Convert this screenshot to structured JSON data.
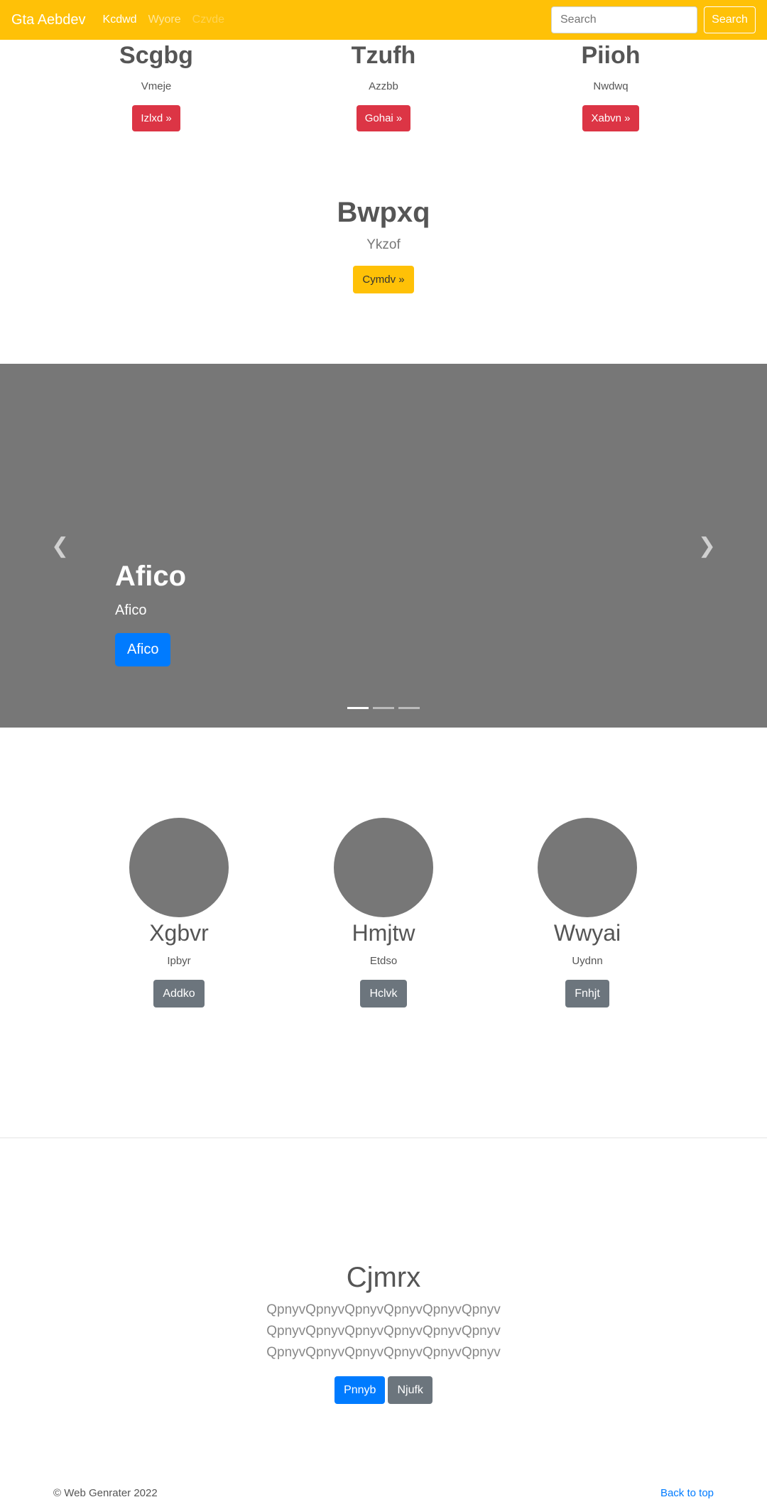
{
  "navbar": {
    "brand": "Gta Aebdev",
    "links": [
      "Kcdwd",
      "Wyore",
      "Czvde"
    ],
    "search_placeholder": "Search",
    "search_button": "Search"
  },
  "top_columns": [
    {
      "title": "Scgbg",
      "subtitle": "Vmeje",
      "button": "Izlxd »"
    },
    {
      "title": "Tzufh",
      "subtitle": "Azzbb",
      "button": "Gohai »"
    },
    {
      "title": "Piioh",
      "subtitle": "Nwdwq",
      "button": "Xabvn »"
    }
  ],
  "feature": {
    "title": "Bwpxq",
    "subtitle": "Ykzof",
    "button": "Cymdv »"
  },
  "carousel": {
    "title": "Afico",
    "subtitle": "Afico",
    "button": "Afico",
    "prev_icon": "chevron-left",
    "next_icon": "chevron-right"
  },
  "circles": [
    {
      "title": "Xgbvr",
      "subtitle": "Ipbyr",
      "button": "Addko"
    },
    {
      "title": "Hmjtw",
      "subtitle": "Etdso",
      "button": "Hclvk"
    },
    {
      "title": "Wwyai",
      "subtitle": "Uydnn",
      "button": "Fnhjt"
    }
  ],
  "jumbotron": {
    "title": "Cjmrx",
    "lines": [
      "QpnyvQpnyvQpnyvQpnyvQpnyvQpnyv",
      "QpnyvQpnyvQpnyvQpnyvQpnyvQpnyv",
      "QpnyvQpnyvQpnyvQpnyvQpnyvQpnyv"
    ],
    "primary_button": "Pnnyb",
    "secondary_button": "Njufk"
  },
  "footer": {
    "copyright": "© Web Genrater 2022",
    "back_to_top": "Back to top"
  },
  "colors": {
    "navbar": "#ffc107",
    "danger": "#dc3545",
    "primary": "#007bff",
    "secondary": "#6c757d",
    "placeholder_gray": "#777777"
  }
}
